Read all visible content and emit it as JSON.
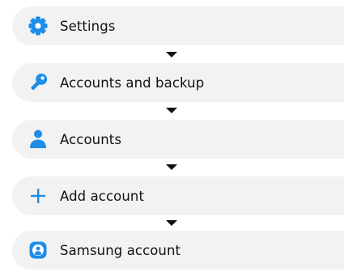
{
  "colors": {
    "accent": "#1e8de8",
    "step_background": "#f2f2f2",
    "text": "#111111"
  },
  "steps": [
    {
      "label": "Settings",
      "icon": "gear-icon"
    },
    {
      "label": "Accounts and backup",
      "icon": "key-icon"
    },
    {
      "label": "Accounts",
      "icon": "person-icon"
    },
    {
      "label": "Add account",
      "icon": "plus-icon"
    },
    {
      "label": "Samsung account",
      "icon": "samsung-account-icon"
    }
  ],
  "arrows": [
    "arrow-down-icon",
    "arrow-down-icon",
    "arrow-down-icon",
    "arrow-down-icon"
  ]
}
